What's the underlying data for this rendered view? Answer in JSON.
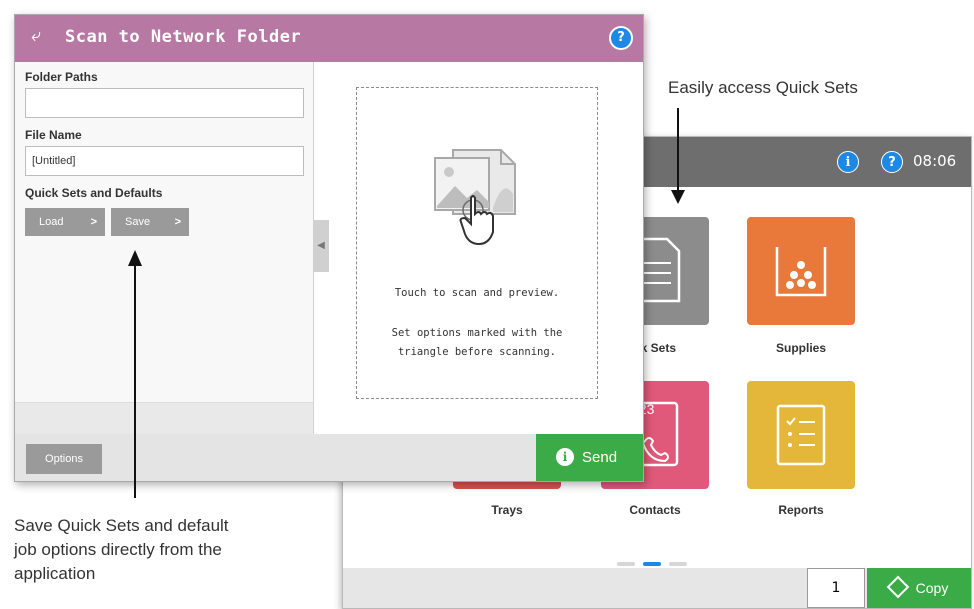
{
  "home": {
    "clock": "08:06",
    "tiles": [
      {
        "label": "ck Sets",
        "color": "#8c8c8c"
      },
      {
        "label": "Supplies",
        "color": "#e8793a"
      },
      {
        "label": "Trays",
        "color": "#d9534f"
      },
      {
        "label": "Contacts",
        "color": "#e0587a"
      },
      {
        "label": "Reports",
        "color": "#e4b73a"
      }
    ],
    "contacts_number": "123",
    "copies_value": "1",
    "copy_label": "Copy"
  },
  "scan": {
    "title": "Scan to Network Folder",
    "folder_paths_label": "Folder Paths",
    "folder_paths_value": "",
    "file_name_label": "File Name",
    "file_name_value": "[Untitled]",
    "quick_sets_label": "Quick Sets and Defaults",
    "load_label": "Load",
    "save_label": "Save",
    "preview_line1": "Touch to scan and preview.",
    "preview_line2a": "Set options marked with the",
    "preview_line2b": "triangle before scanning.",
    "options_label": "Options",
    "send_label": "Send"
  },
  "annotations": {
    "top_callout": "Easily access Quick Sets",
    "bottom_callout_1": "Save Quick Sets and default",
    "bottom_callout_2": "job options directly from the",
    "bottom_callout_3": "application"
  }
}
